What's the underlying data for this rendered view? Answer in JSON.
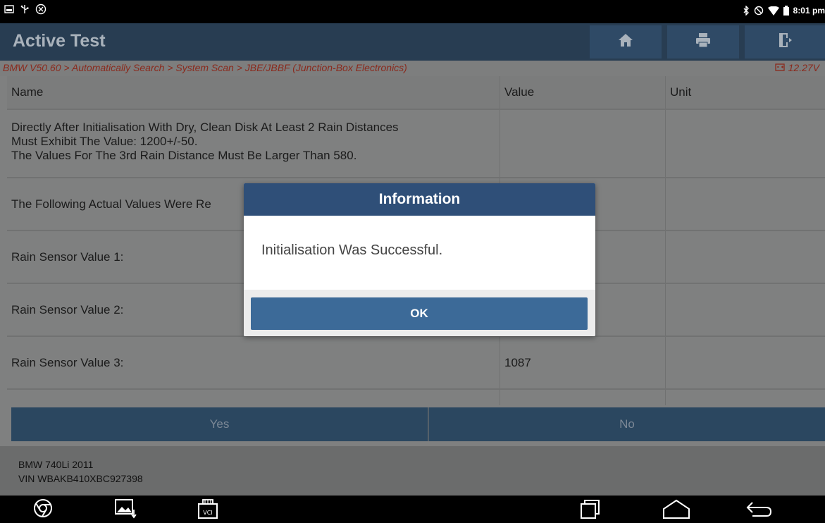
{
  "statusbar": {
    "time": "8:01 pm",
    "icons": [
      "gallery-icon",
      "usb-icon",
      "settings-icon",
      "bluetooth-icon",
      "no-disturb-icon",
      "wifi-icon",
      "battery-icon"
    ]
  },
  "app": {
    "title": "Active Test",
    "toolbar": [
      "home-icon",
      "print-icon",
      "exit-icon"
    ],
    "breadcrumb": "BMW V50.60 > Automatically Search > System Scan > JBE/JBBF (Junction-Box Electronics)",
    "voltage": "12.27V"
  },
  "table": {
    "headers": {
      "name": "Name",
      "value": "Value",
      "unit": "Unit"
    },
    "rows": [
      {
        "name": "Directly After Initialisation With Dry, Clean Disk At Least 2 Rain Distances\nMust Exhibit The Value: 1200+/-50.\nThe Values For The 3rd Rain Distance Must Be Larger Than 580.",
        "value": "",
        "unit": ""
      },
      {
        "name": "The Following Actual Values Were Re",
        "value": "",
        "unit": ""
      },
      {
        "name": "Rain Sensor Value 1:",
        "value": "",
        "unit": ""
      },
      {
        "name": "Rain Sensor Value 2:",
        "value": "",
        "unit": ""
      },
      {
        "name": "Rain Sensor Value 3:",
        "value": "1087",
        "unit": ""
      }
    ]
  },
  "buttons": {
    "yes": "Yes",
    "no": "No"
  },
  "footer": {
    "car": "BMW 740Li 2011",
    "vin": "VIN WBAKB410XBC927398"
  },
  "navbar": [
    "chrome-icon",
    "screenshot-icon",
    "vci-icon",
    "recent-apps-icon",
    "home-nav-icon",
    "back-icon"
  ],
  "dialog": {
    "title": "Information",
    "message": "Initialisation Was Successful.",
    "ok": "OK"
  },
  "colors": {
    "titlebar": "#283d52",
    "dialog_header": "#2f4f78",
    "dialog_button": "#3c6a98",
    "breadcrumb_text": "#8a2a1d"
  }
}
